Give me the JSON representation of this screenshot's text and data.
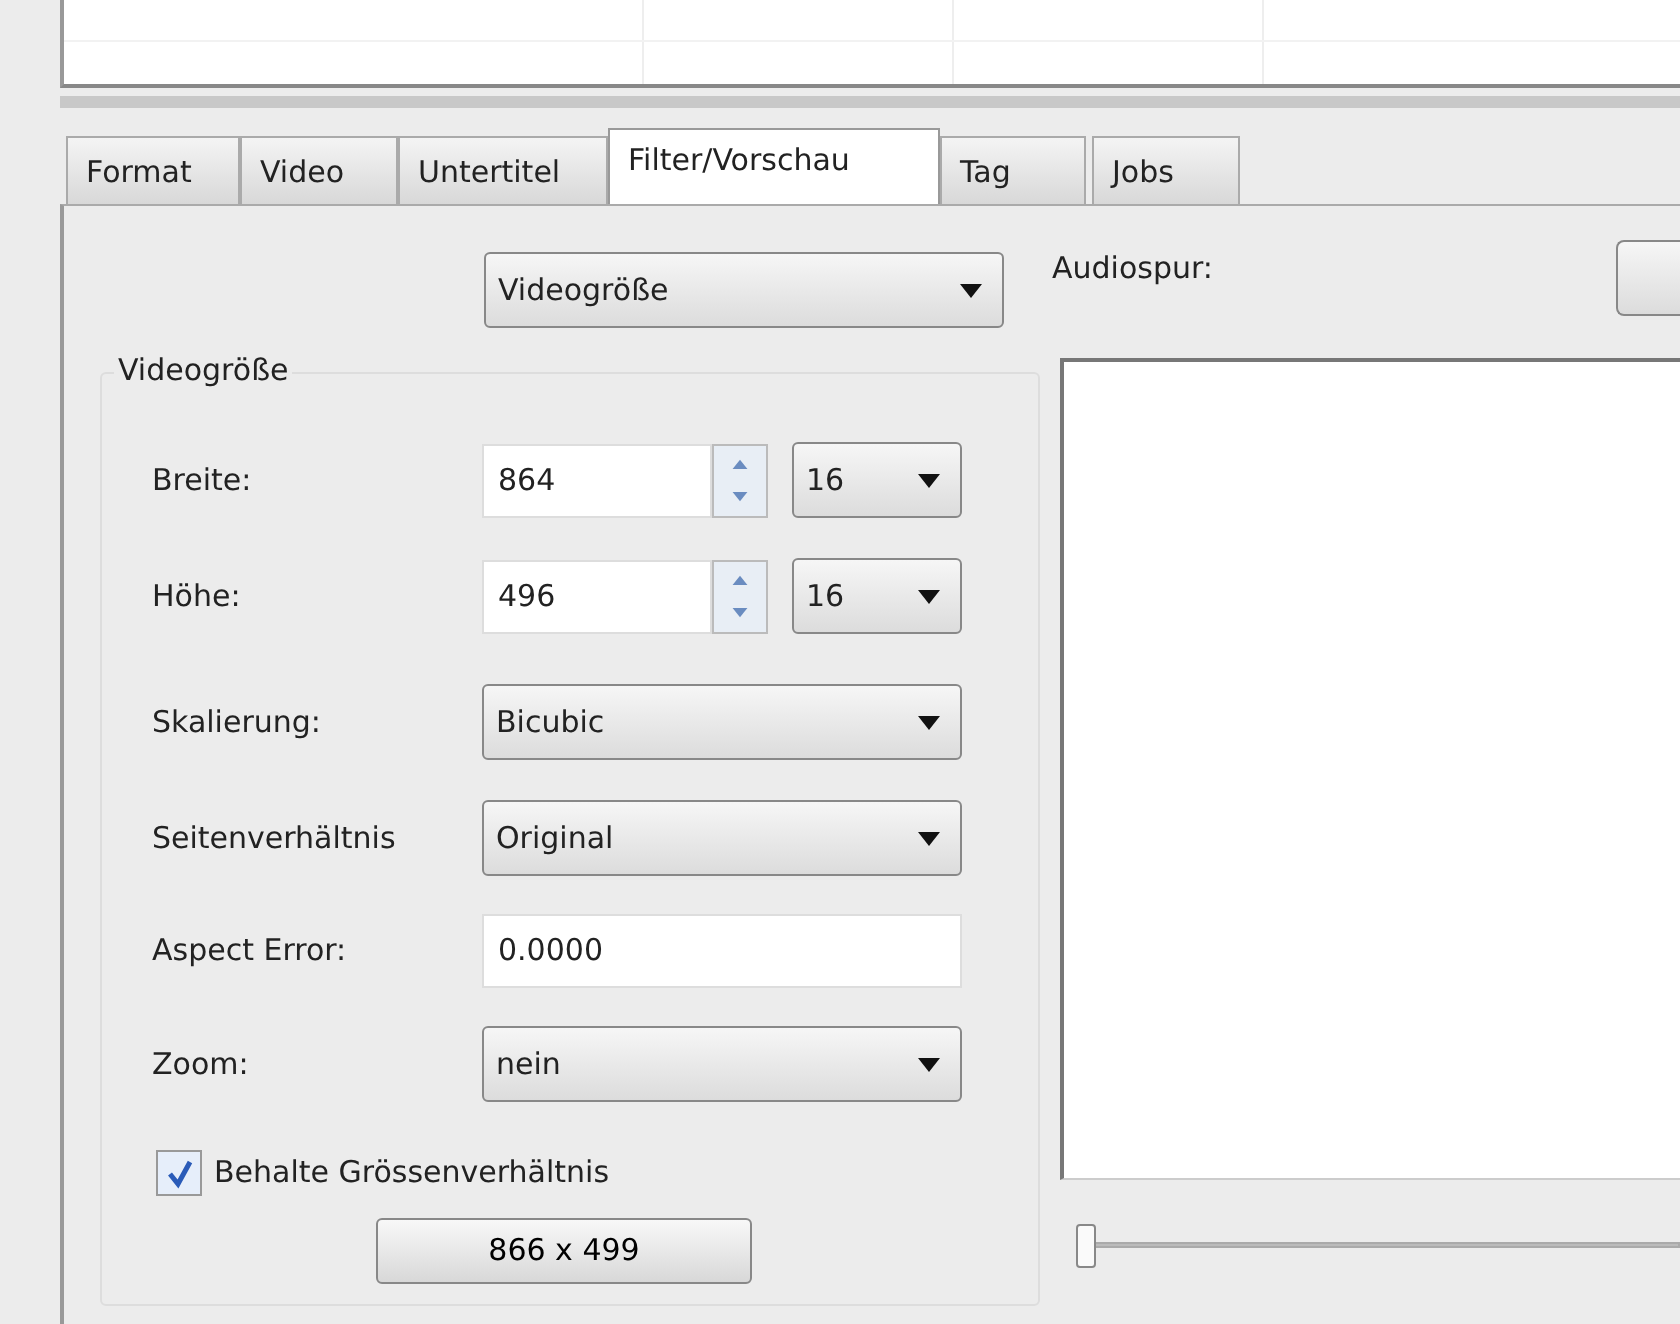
{
  "tabs": [
    {
      "label": "Format",
      "selected": false
    },
    {
      "label": "Video",
      "selected": false
    },
    {
      "label": "Untertitel",
      "selected": false
    },
    {
      "label": "Filter/Vorschau",
      "selected": true
    },
    {
      "label": "Tag",
      "selected": false
    },
    {
      "label": "Jobs",
      "selected": false
    }
  ],
  "filter_select": {
    "value": "Videogröße"
  },
  "group": {
    "title": "Videogröße",
    "rows": [
      {
        "kind": "spin",
        "label": "Breite:",
        "value": "864",
        "step": "16"
      },
      {
        "kind": "spin",
        "label": "Höhe:",
        "value": "496",
        "step": "16"
      },
      {
        "kind": "select",
        "label": "Skalierung:",
        "value": "Bicubic"
      },
      {
        "kind": "select",
        "label": "Seitenverhältnis",
        "value": "Original"
      },
      {
        "kind": "text",
        "label": "Aspect Error:",
        "value": "0.0000"
      },
      {
        "kind": "select",
        "label": "Zoom:",
        "value": "nein"
      }
    ],
    "keep_ratio": {
      "label": "Behalte Grössenverhältnis",
      "checked": true
    },
    "size_button": "866 x 499"
  },
  "preview": {
    "audio_label": "Audiospur:",
    "slider": {
      "level": 0
    }
  }
}
